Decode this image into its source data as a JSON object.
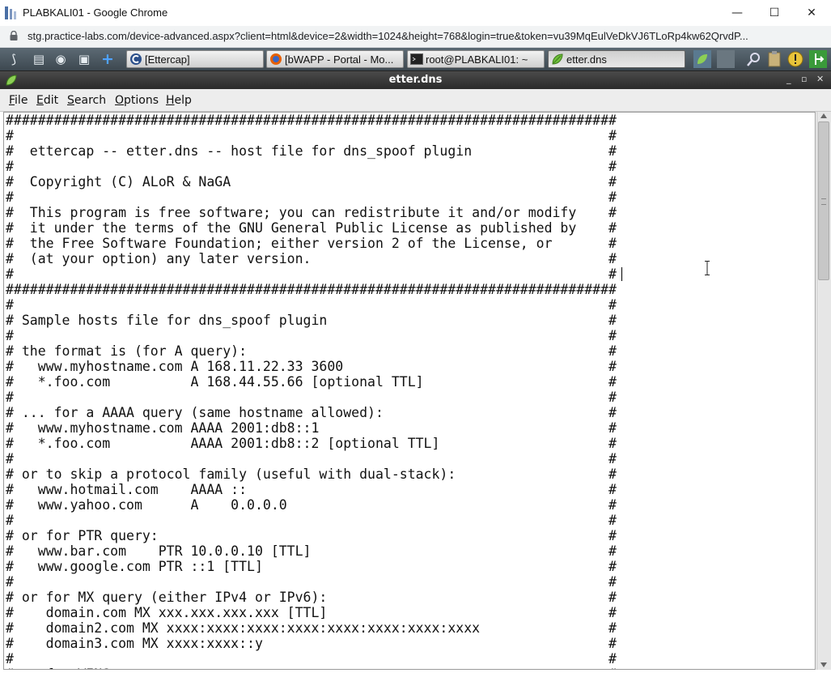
{
  "chrome": {
    "title": "PLABKALI01 - Google Chrome",
    "url": "stg.practice-labs.com/device-advanced.aspx?client=html&device=2&width=1024&height=768&login=true&token=vu39MqEulVeDkVJ6TLoRp4kw62QrvdP...",
    "minimize_glyph": "—",
    "maximize_glyph": "☐",
    "close_glyph": "✕"
  },
  "panel": {
    "launchers": [
      {
        "name": "kali-menu-icon",
        "glyph": "⟆"
      },
      {
        "name": "files-icon",
        "glyph": "▤"
      },
      {
        "name": "browser-globe-icon",
        "glyph": "◉"
      },
      {
        "name": "windows-icon",
        "glyph": "▣"
      },
      {
        "name": "add-icon",
        "glyph": "+"
      }
    ],
    "tasks": [
      {
        "label": "[Ettercap]",
        "icon": "ettercap-icon"
      },
      {
        "label": "[bWAPP - Portal - Mo...",
        "icon": "firefox-icon"
      },
      {
        "label": "root@PLABKALI01: ~",
        "icon": "terminal-icon"
      },
      {
        "label": "etter.dns",
        "icon": "gedit-icon"
      }
    ]
  },
  "gedit": {
    "title": "etter.dns",
    "buttons": [
      "_",
      "▫",
      "✕"
    ]
  },
  "menu": {
    "items": [
      {
        "underline": "F",
        "rest": "ile"
      },
      {
        "underline": "E",
        "rest": "dit"
      },
      {
        "underline": "S",
        "rest": "earch"
      },
      {
        "underline": "O",
        "rest": "ptions"
      },
      {
        "underline": "H",
        "rest": "elp"
      }
    ]
  },
  "editor": {
    "lines": [
      "############################################################################",
      "#                                                                          #",
      "#  ettercap -- etter.dns -- host file for dns_spoof plugin                 #",
      "#                                                                          #",
      "#  Copyright (C) ALoR & NaGA                                               #",
      "#                                                                          #",
      "#  This program is free software; you can redistribute it and/or modify    #",
      "#  it under the terms of the GNU General Public License as published by    #",
      "#  the Free Software Foundation; either version 2 of the License, or       #",
      "#  (at your option) any later version.                                     #",
      "#                                                                          #",
      "############################################################################",
      "#                                                                          #",
      "# Sample hosts file for dns_spoof plugin                                   #",
      "#                                                                          #",
      "# the format is (for A query):                                             #",
      "#   www.myhostname.com A 168.11.22.33 3600                                 #",
      "#   *.foo.com          A 168.44.55.66 [optional TTL]                       #",
      "#                                                                          #",
      "# ... for a AAAA query (same hostname allowed):                            #",
      "#   www.myhostname.com AAAA 2001:db8::1                                    #",
      "#   *.foo.com          AAAA 2001:db8::2 [optional TTL]                     #",
      "#                                                                          #",
      "# or to skip a protocol family (useful with dual-stack):                   #",
      "#   www.hotmail.com    AAAA ::                                             #",
      "#   www.yahoo.com      A    0.0.0.0                                        #",
      "#                                                                          #",
      "# or for PTR query:                                                        #",
      "#   www.bar.com    PTR 10.0.0.10 [TTL]                                     #",
      "#   www.google.com PTR ::1 [TTL]                                           #",
      "#                                                                          #",
      "# or for MX query (either IPv4 or IPv6):                                   #",
      "#    domain.com MX xxx.xxx.xxx.xxx [TTL]                                   #",
      "#    domain2.com MX xxxx:xxxx:xxxx:xxxx:xxxx:xxxx:xxxx:xxxx                #",
      "#    domain3.com MX xxxx:xxxx::y                                           #",
      "#                                                                          #",
      "# or for WINS query:                                                       #"
    ]
  },
  "colors": {
    "panel_bg": "#3d4850",
    "gedit_title_bg": "#2b2b2b",
    "menubar_bg": "#ededed"
  }
}
